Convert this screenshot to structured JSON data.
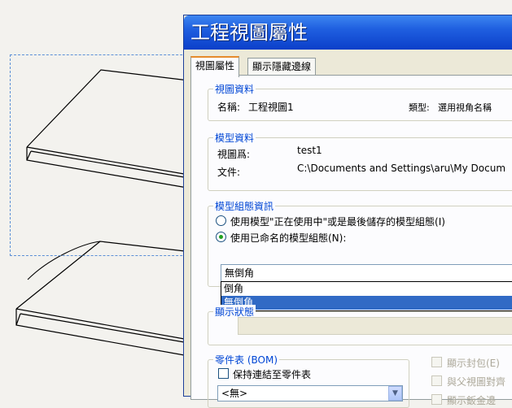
{
  "dialog": {
    "title": "工程視圖屬性",
    "tabs": [
      {
        "label": "視圖屬性",
        "active": true
      },
      {
        "label": "顯示隱藏邊線",
        "active": false
      }
    ]
  },
  "view_properties": {
    "group_title": "視圖資料",
    "name_label": "名稱:",
    "name_value": "工程視圖1",
    "type_label": "類型:",
    "type_value": "選用視角名稱"
  },
  "model_info": {
    "group_title": "模型資料",
    "view_of_label": "視圖爲:",
    "view_of_value": "test1",
    "document_label": "文件:",
    "document_value": "C:\\Documents and Settings\\aru\\My Docum"
  },
  "configuration": {
    "group_title": "模型組態資訊",
    "radio_use_in_use": "使用模型\"正在使用中\"或是最後儲存的模型組態(I)",
    "radio_use_named": "使用已命名的模型組態(N):",
    "selected_value": "無倒角",
    "options": [
      "倒角",
      "無倒角"
    ],
    "selected_option_index": 1
  },
  "display_state": {
    "group_title": "顯示狀態"
  },
  "bom": {
    "group_title": "零件表 (BOM)",
    "keep_linked_label": "保持連結至零件表",
    "bom_select_value": "<無>"
  },
  "right_options": {
    "show_envelope": "顯示封包(E)",
    "align_parent": "與父視圖對齊",
    "show_sheet_metal": "顯示鈑金邊"
  }
}
